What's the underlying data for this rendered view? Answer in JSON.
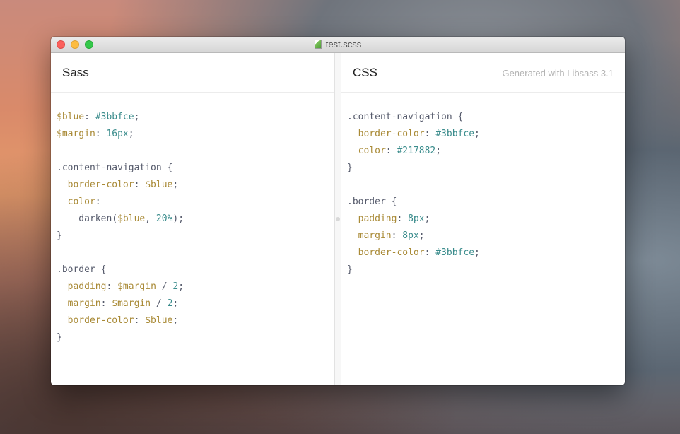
{
  "window": {
    "title": "test.scss"
  },
  "panes": {
    "left": {
      "title": "Sass"
    },
    "right": {
      "title": "CSS",
      "subtitle": "Generated with Libsass 3.1"
    }
  },
  "colors": {
    "var": "#a98a36",
    "property": "#a98a36",
    "value": "#3a8c8c",
    "selector": "#555a6b",
    "close": "#fc605c",
    "minimize": "#fdbc40",
    "zoom": "#34c84a"
  },
  "icons": {
    "file": "sass-file-icon"
  },
  "sass_code": [
    [
      [
        "var",
        "$blue"
      ],
      [
        "punct",
        ": "
      ],
      [
        "val",
        "#3bbfce"
      ],
      [
        "punct",
        ";"
      ]
    ],
    [
      [
        "var",
        "$margin"
      ],
      [
        "punct",
        ": "
      ],
      [
        "val",
        "16px"
      ],
      [
        "punct",
        ";"
      ]
    ],
    [],
    [
      [
        "sel",
        ".content-navigation {"
      ]
    ],
    [
      [
        "punct",
        "  "
      ],
      [
        "prop",
        "border-color"
      ],
      [
        "punct",
        ": "
      ],
      [
        "var",
        "$blue"
      ],
      [
        "punct",
        ";"
      ]
    ],
    [
      [
        "punct",
        "  "
      ],
      [
        "prop",
        "color"
      ],
      [
        "punct",
        ":"
      ]
    ],
    [
      [
        "punct",
        "    darken("
      ],
      [
        "var",
        "$blue"
      ],
      [
        "punct",
        ", "
      ],
      [
        "val",
        "20%"
      ],
      [
        "punct",
        ");"
      ]
    ],
    [
      [
        "sel",
        "}"
      ]
    ],
    [],
    [
      [
        "sel",
        ".border {"
      ]
    ],
    [
      [
        "punct",
        "  "
      ],
      [
        "prop",
        "padding"
      ],
      [
        "punct",
        ": "
      ],
      [
        "var",
        "$margin"
      ],
      [
        "punct",
        " / "
      ],
      [
        "val",
        "2"
      ],
      [
        "punct",
        ";"
      ]
    ],
    [
      [
        "punct",
        "  "
      ],
      [
        "prop",
        "margin"
      ],
      [
        "punct",
        ": "
      ],
      [
        "var",
        "$margin"
      ],
      [
        "punct",
        " / "
      ],
      [
        "val",
        "2"
      ],
      [
        "punct",
        ";"
      ]
    ],
    [
      [
        "punct",
        "  "
      ],
      [
        "prop",
        "border-color"
      ],
      [
        "punct",
        ": "
      ],
      [
        "var",
        "$blue"
      ],
      [
        "punct",
        ";"
      ]
    ],
    [
      [
        "sel",
        "}"
      ]
    ]
  ],
  "css_code": [
    [
      [
        "sel",
        ".content-navigation {"
      ]
    ],
    [
      [
        "punct",
        "  "
      ],
      [
        "prop",
        "border-color"
      ],
      [
        "punct",
        ": "
      ],
      [
        "val",
        "#3bbfce"
      ],
      [
        "punct",
        ";"
      ]
    ],
    [
      [
        "punct",
        "  "
      ],
      [
        "prop",
        "color"
      ],
      [
        "punct",
        ": "
      ],
      [
        "val",
        "#217882"
      ],
      [
        "punct",
        ";"
      ]
    ],
    [
      [
        "sel",
        "}"
      ]
    ],
    [],
    [
      [
        "sel",
        ".border {"
      ]
    ],
    [
      [
        "punct",
        "  "
      ],
      [
        "prop",
        "padding"
      ],
      [
        "punct",
        ": "
      ],
      [
        "val",
        "8px"
      ],
      [
        "punct",
        ";"
      ]
    ],
    [
      [
        "punct",
        "  "
      ],
      [
        "prop",
        "margin"
      ],
      [
        "punct",
        ": "
      ],
      [
        "val",
        "8px"
      ],
      [
        "punct",
        ";"
      ]
    ],
    [
      [
        "punct",
        "  "
      ],
      [
        "prop",
        "border-color"
      ],
      [
        "punct",
        ": "
      ],
      [
        "val",
        "#3bbfce"
      ],
      [
        "punct",
        ";"
      ]
    ],
    [
      [
        "sel",
        "}"
      ]
    ]
  ]
}
